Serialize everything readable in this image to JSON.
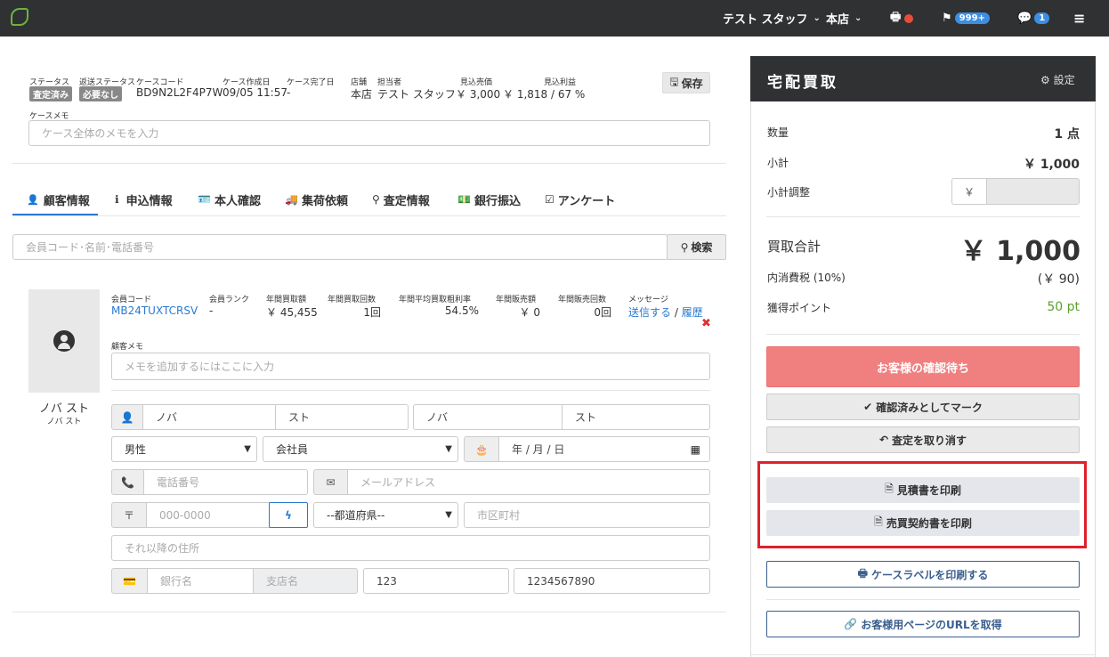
{
  "topbar": {
    "user": "テスト スタッフ",
    "store": "本店",
    "flag_count": "999+",
    "chat_count": "1"
  },
  "case": {
    "labels": {
      "status": "ステータス",
      "return_status": "返送ステータス",
      "code": "ケースコード",
      "created": "ケース作成日",
      "completed": "ケース完了日",
      "store": "店舗",
      "staff": "担当者",
      "expected_sales": "見込売価",
      "expected_profit": "見込利益",
      "memo": "ケースメモ"
    },
    "status": "査定済み",
    "return_status": "必要なし",
    "code": "BD9N2L2F4P7W",
    "created": "09/05 11:57",
    "completed": "-",
    "store": "本店",
    "staff": "テスト スタッフ",
    "expected_sales": "￥ 3,000",
    "expected_profit": "￥ 1,818 / 67 %",
    "save": "保存",
    "memo_placeholder": "ケース全体のメモを入力"
  },
  "tabs": [
    "顧客情報",
    "申込情報",
    "本人確認",
    "集荷依頼",
    "査定情報",
    "銀行振込",
    "アンケート"
  ],
  "search": {
    "placeholder": "会員コード･名前･電話番号",
    "button": "検索"
  },
  "customer": {
    "name": "ノバ スト",
    "kana": "ノバ スト",
    "labels": {
      "code": "会員コード",
      "rank": "会員ランク",
      "annual_amount": "年間買取額",
      "annual_count": "年間買取回数",
      "avg_margin": "年間平均買取粗利率",
      "sales_amount": "年間販売額",
      "sales_count": "年間販売回数",
      "message": "メッセージ",
      "memo": "顧客メモ"
    },
    "code": "MB24TUXTCRSV",
    "rank": "-",
    "annual_amount": "￥ 45,455",
    "annual_count": "1回",
    "avg_margin": "54.5%",
    "sales_amount": "￥ 0",
    "sales_count": "0回",
    "send": "送信する",
    "sep": " / ",
    "history": "履歴",
    "memo_placeholder": "メモを追加するにはここに入力",
    "last": "ノバ",
    "first": "スト",
    "last_kana": "ノバ",
    "first_kana": "スト",
    "gender": "男性",
    "job": "会社員",
    "birthday": "年 / 月 / 日",
    "phone_placeholder": "電話番号",
    "email_placeholder": "メールアドレス",
    "zip_placeholder": "000-0000",
    "pref": "--都道府県--",
    "city_placeholder": "市区町村",
    "addr_placeholder": "それ以降の住所",
    "bank_placeholder": "銀行名",
    "branch_placeholder": "支店名",
    "account_type": "123",
    "account_no": "1234567890",
    "zip_symbol": "〒"
  },
  "right": {
    "title": "宅配買取",
    "settings": "設定",
    "qty_label": "数量",
    "qty": "1 点",
    "subtotal_label": "小計",
    "subtotal": "￥ 1,000",
    "adjust_label": "小計調整",
    "yen": "￥",
    "total_label": "買取合計",
    "total": "￥ 1,000",
    "tax_label": "内消費税 (10%)",
    "tax": "(￥ 90)",
    "points_label": "獲得ポイント",
    "points": "50 pt",
    "status_btn": "お客様の確認待ち",
    "mark_btn": "確認済みとしてマーク",
    "cancel_btn": "査定を取り消す",
    "quote_btn": "見積書を印刷",
    "contract_btn": "売買契約書を印刷",
    "label_btn": "ケースラベルを印刷する",
    "url_btn": "お客様用ページのURLを取得"
  },
  "colors": {
    "topbar": "#2f3133",
    "link": "#2a7ad1",
    "status_btn": "#f08080",
    "points": "#5aa02c",
    "highlight": "#e0202a"
  }
}
